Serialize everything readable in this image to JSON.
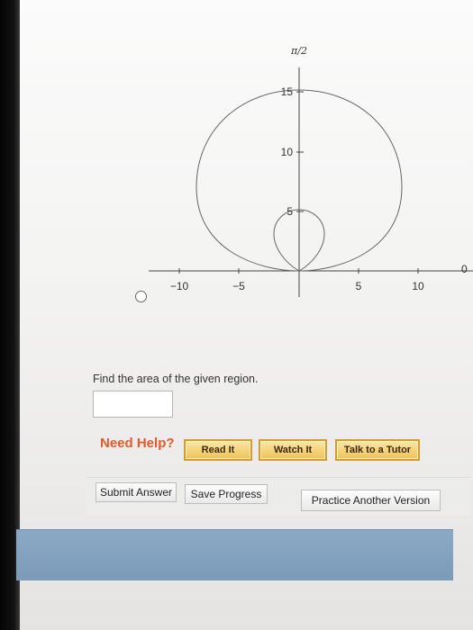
{
  "graph": {
    "pole_label": "π/2",
    "zero_label": "0",
    "x_tick_labels": [
      "−10",
      "−5",
      "5",
      "10"
    ],
    "y_tick_labels": [
      "15",
      "10",
      "5"
    ]
  },
  "question": {
    "text": "Find the area of the given region."
  },
  "answer": {
    "value": ""
  },
  "help": {
    "label": "Need Help?",
    "read_it": "Read It",
    "watch_it": "Watch It",
    "talk_to_tutor": "Talk to a Tutor"
  },
  "actions": {
    "submit": "Submit Answer",
    "save": "Save Progress",
    "practice": "Practice Another Version"
  },
  "colors": {
    "need_help": "#e05a2a",
    "help_button_fill": "#f0c257",
    "bottom_bar": "#7b9bb9"
  }
}
